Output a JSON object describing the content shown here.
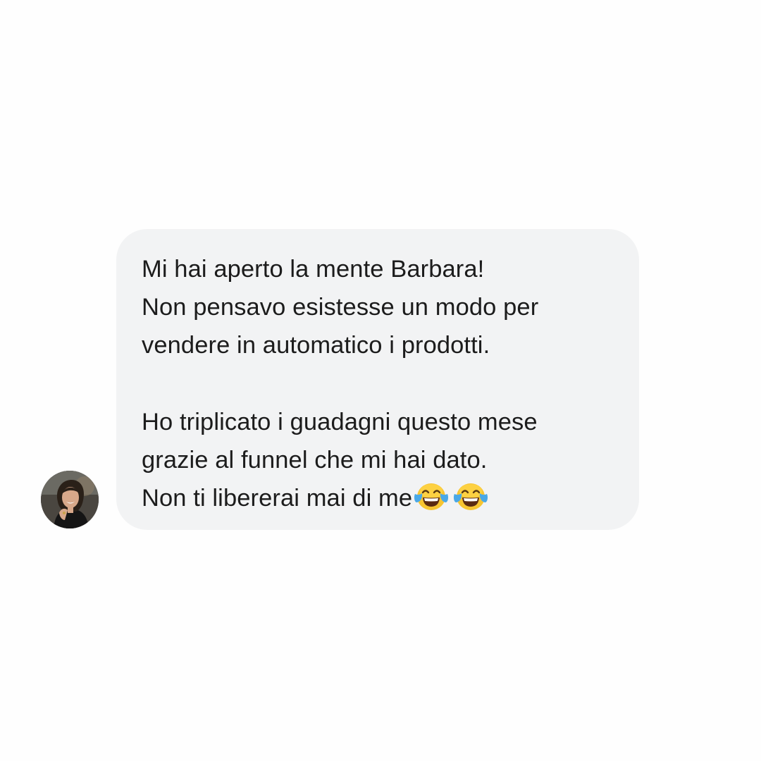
{
  "conversation": {
    "avatar": {
      "icon": "profile-photo-avatar"
    },
    "message": {
      "paragraph1": [
        "Mi hai aperto la mente Barbara!",
        "Non pensavo esistesse un modo per",
        "vendere in automatico i prodotti."
      ],
      "paragraph2": [
        "Ho triplicato i guadagni questo mese",
        "grazie al funnel che mi hai dato.",
        "Non ti libererai mai di me"
      ],
      "emojis": [
        "face-with-tears-of-joy-icon",
        "face-with-tears-of-joy-icon"
      ]
    },
    "colors": {
      "bubble": "#f2f3f4",
      "text": "#1c1c1c",
      "background": "#fefefe"
    }
  }
}
